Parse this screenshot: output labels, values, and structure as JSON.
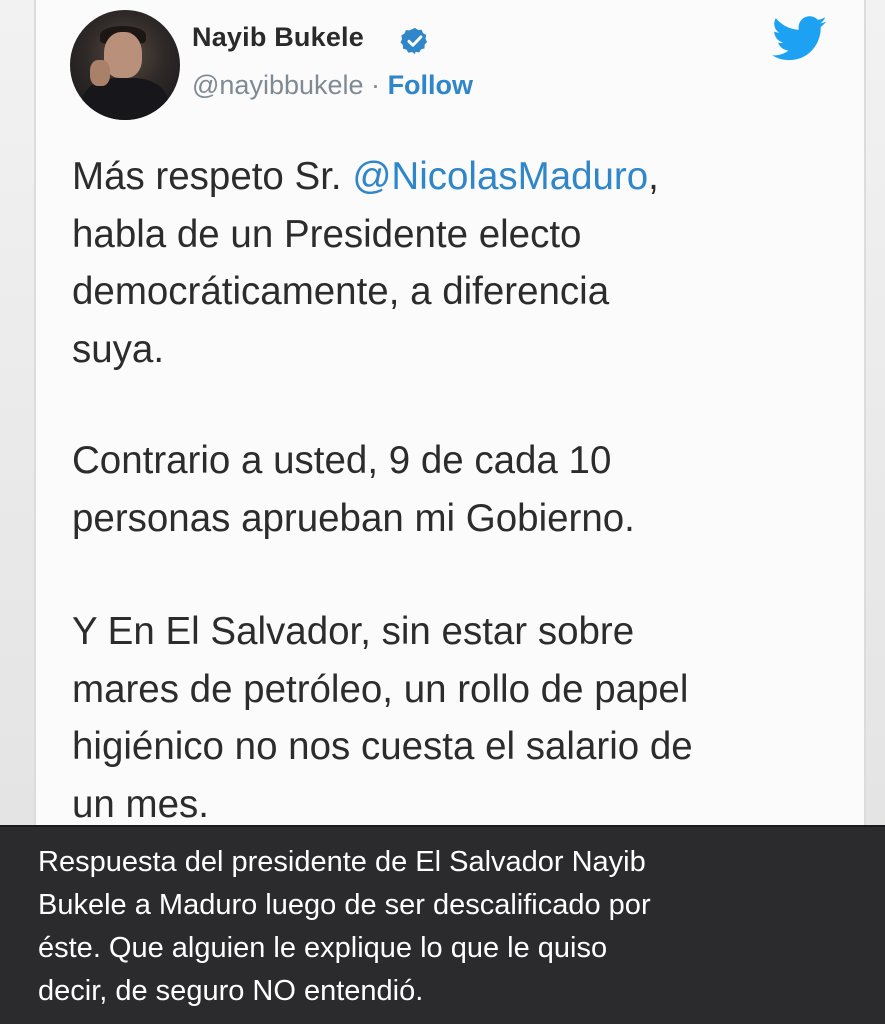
{
  "tweet": {
    "author_name": "Nayib Bukele",
    "handle": "@nayibbukele",
    "separator": "·",
    "follow_label": "Follow",
    "body": {
      "p1": {
        "line1_prefix": "Más respeto Sr. ",
        "line1_mention": "@NicolasMaduro",
        "line1_suffix": ",",
        "line2": "habla de un Presidente electo",
        "line3": "democráticamente, a diferencia",
        "line4": "suya."
      },
      "p2": {
        "line1": "Contrario a usted, 9 de cada 10",
        "line2": "personas aprueban mi Gobierno."
      },
      "p3": {
        "line1": "Y En El Salvador, sin estar sobre",
        "line2": "mares de petróleo, un rollo de papel",
        "line3": "higiénico no nos cuesta el salario de",
        "line4": "un mes."
      }
    },
    "icons": {
      "verified": "verified-badge-icon",
      "brand": "twitter-bird-icon",
      "avatar": "profile-photo"
    },
    "colors": {
      "link_blue": "#2f86c8",
      "twitter_blue": "#1da1f2",
      "text": "#2c2c2c",
      "handle_gray": "#7f8a94"
    }
  },
  "caption": {
    "line1": "Respuesta del presidente de El Salvador Nayib",
    "line2": "Bukele a Maduro luego de ser descalificado por",
    "line3": "éste. Que alguien le explique lo que le quiso",
    "line4": "decir, de seguro NO entendió.",
    "background": "#2b2b2d",
    "text_color": "#ffffff"
  }
}
